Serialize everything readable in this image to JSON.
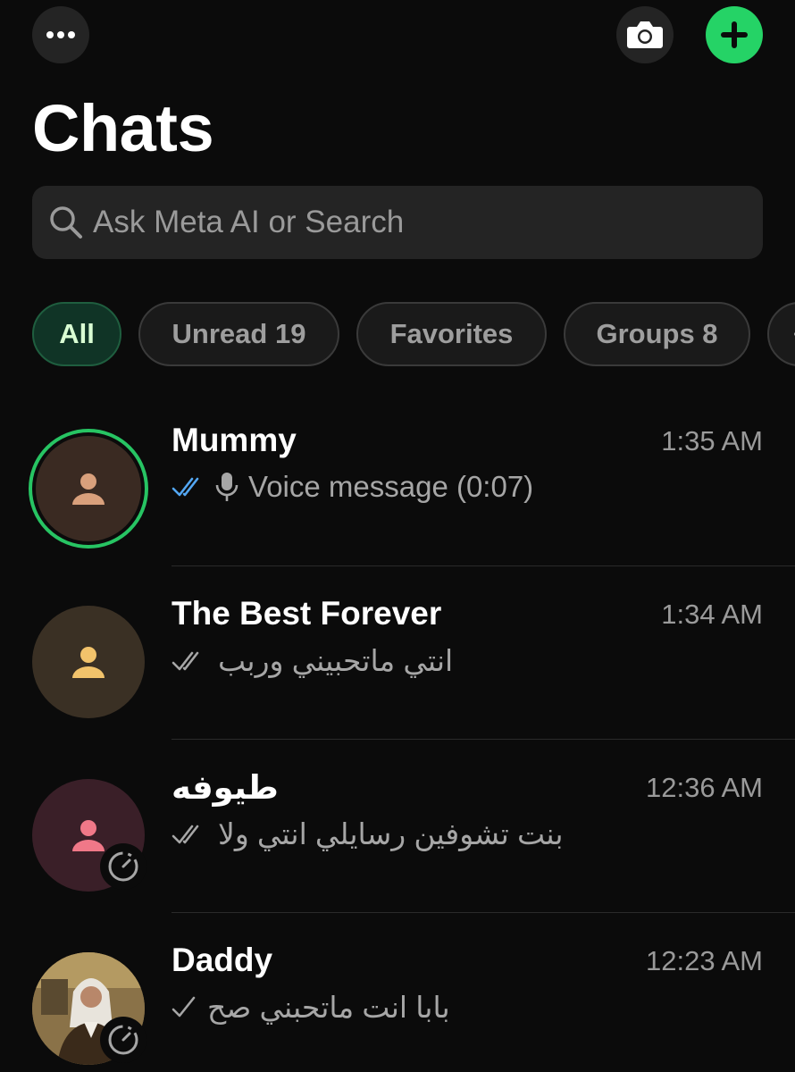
{
  "header": {
    "title": "Chats",
    "more_icon": "more-horizontal-icon",
    "camera_icon": "camera-icon",
    "new_chat_icon": "plus-icon",
    "accent_color": "#25d366"
  },
  "search": {
    "placeholder": "Ask Meta AI or Search"
  },
  "filters": [
    {
      "label": "All",
      "active": true
    },
    {
      "label": "Unread 19",
      "active": false
    },
    {
      "label": "Favorites",
      "active": false
    },
    {
      "label": "Groups 8",
      "active": false
    }
  ],
  "chats": [
    {
      "name": "Mummy",
      "time": "1:35 AM",
      "preview": "Voice message (0:07)",
      "receipt": "read-blue",
      "has_status_ring": true,
      "avatar_color": "#3a2a22",
      "icon_color": "#d9a07c"
    },
    {
      "name": "The Best Forever",
      "time": "1:34 AM",
      "preview": "انتي ماتحبيني وربب",
      "receipt": "delivered",
      "avatar_color": "#3a3024",
      "icon_color": "#f2c36b"
    },
    {
      "name": "طيوفه",
      "time": "12:36 AM",
      "preview": "بنت تشوفين رسايلي انتي ولا",
      "receipt": "delivered",
      "has_status_badge": true,
      "avatar_color": "#3a1f28",
      "icon_color": "#f07888"
    },
    {
      "name": "Daddy",
      "time": "12:23 AM",
      "preview": "بابا انت ماتحبني صح",
      "receipt": "sent",
      "has_status_badge": true,
      "photo_avatar": true
    }
  ]
}
